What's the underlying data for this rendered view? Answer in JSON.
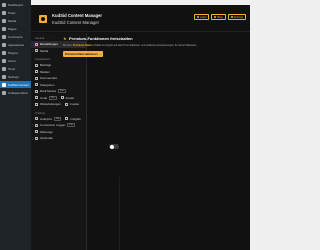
{
  "wp_sidebar": {
    "items": [
      {
        "label": "Dashboard",
        "icon": "dashboard-icon"
      },
      {
        "label": "Posts",
        "icon": "pin-icon"
      },
      {
        "label": "Media",
        "icon": "media-icon"
      },
      {
        "label": "Pages",
        "icon": "page-icon"
      },
      {
        "label": "Comments",
        "icon": "comment-icon"
      },
      {
        "label": "Appearance",
        "icon": "brush-icon"
      },
      {
        "label": "Plugins",
        "icon": "plug-icon"
      },
      {
        "label": "Users",
        "icon": "user-icon"
      },
      {
        "label": "Tools",
        "icon": "wrench-icon"
      },
      {
        "label": "Settings",
        "icon": "settings-icon"
      },
      {
        "label": "KudSid Content",
        "icon": "kudsid-icon",
        "active": true
      },
      {
        "label": "Collapse Menu",
        "icon": "collapse-icon"
      }
    ]
  },
  "header": {
    "title": "KudSid Content Manager",
    "subtitle": "KudSid Content Manager",
    "buttons": [
      {
        "label": "Label"
      },
      {
        "label": "Blog"
      },
      {
        "label": "Settings"
      }
    ]
  },
  "plugin_nav": {
    "section_general": "General",
    "general_items": [
      {
        "label": "Einstellungen",
        "active": true
      },
      {
        "label": "Media"
      }
    ],
    "section_integrations": "Integrationen",
    "integration_items": [
      {
        "label": "Beiträge"
      },
      {
        "label": "Medien"
      },
      {
        "label": "Kommentare"
      },
      {
        "label": "Kategorien"
      },
      {
        "label": "Dark Modus",
        "tag": "Pro"
      }
    ],
    "pair_items": [
      {
        "label": "Code",
        "tag": "Pro"
      },
      {
        "label": "Footer",
        "tag": "Pro"
      }
    ],
    "pair_items_2": [
      {
        "label": "Weiterleitungen"
      },
      {
        "label": "Cookie",
        "tag": "Pro"
      }
    ],
    "section_tracking": "Tracking",
    "tracking_pair_1": [
      {
        "label": "Analytics",
        "tag": "Pro"
      },
      {
        "label": "Insights",
        "tag": "Pro"
      }
    ],
    "tracking_pair_2": [
      {
        "label": "Conversion Logger",
        "tag": "Pro"
      },
      {
        "label": "Conversion Logger",
        "tag": "Pro"
      }
    ],
    "extra_items": [
      {
        "label": "Wartungs"
      },
      {
        "label": "Optionale"
      }
    ]
  },
  "content": {
    "pro_title": "Premium-Funktionen freischalten",
    "pro_desc_prefix": "Mit dem ",
    "pro_desc_bold": "Premium-Paket",
    "pro_desc_rest": " erhältst du Zugriff auf alle Pro-Funktionen und exklusive Erweiterungen für deine Webseite.",
    "pro_button": "Premium-Paket aktivieren →"
  },
  "colors": {
    "accent": "#f2b134",
    "wp_active": "#2271b1",
    "panel_bg": "#111111"
  },
  "toggle": {
    "state": "off"
  }
}
